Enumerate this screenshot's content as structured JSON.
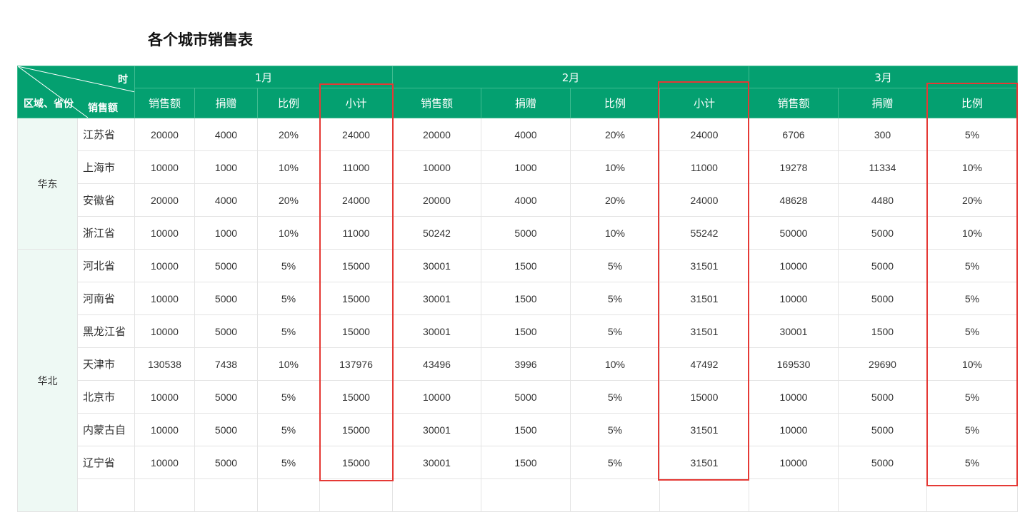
{
  "title": "各个城市销售表",
  "header": {
    "corner": {
      "time": "时",
      "region": "区域、省份",
      "sales": "销售额"
    },
    "months": [
      "1月",
      "2月",
      "3月"
    ],
    "subcols": {
      "sales": "销售额",
      "donation": "捐赠",
      "ratio": "比例",
      "subtotal": "小计"
    }
  },
  "regions": [
    {
      "name": "华东",
      "rows": [
        {
          "province": "江苏省",
          "m1": [
            "20000",
            "4000",
            "20%",
            "24000"
          ],
          "m2": [
            "20000",
            "4000",
            "20%",
            "24000"
          ],
          "m3": [
            "6706",
            "300",
            "5%"
          ]
        },
        {
          "province": "上海市",
          "m1": [
            "10000",
            "1000",
            "10%",
            "11000"
          ],
          "m2": [
            "10000",
            "1000",
            "10%",
            "11000"
          ],
          "m3": [
            "19278",
            "11334",
            "10%"
          ]
        },
        {
          "province": "安徽省",
          "m1": [
            "20000",
            "4000",
            "20%",
            "24000"
          ],
          "m2": [
            "20000",
            "4000",
            "20%",
            "24000"
          ],
          "m3": [
            "48628",
            "4480",
            "20%"
          ]
        },
        {
          "province": "浙江省",
          "m1": [
            "10000",
            "1000",
            "10%",
            "11000"
          ],
          "m2": [
            "50242",
            "5000",
            "10%",
            "55242"
          ],
          "m3": [
            "50000",
            "5000",
            "10%"
          ]
        }
      ]
    },
    {
      "name": "华北",
      "rows": [
        {
          "province": "河北省",
          "m1": [
            "10000",
            "5000",
            "5%",
            "15000"
          ],
          "m2": [
            "30001",
            "1500",
            "5%",
            "31501"
          ],
          "m3": [
            "10000",
            "5000",
            "5%"
          ]
        },
        {
          "province": "河南省",
          "m1": [
            "10000",
            "5000",
            "5%",
            "15000"
          ],
          "m2": [
            "30001",
            "1500",
            "5%",
            "31501"
          ],
          "m3": [
            "10000",
            "5000",
            "5%"
          ]
        },
        {
          "province": "黑龙江省",
          "m1": [
            "10000",
            "5000",
            "5%",
            "15000"
          ],
          "m2": [
            "30001",
            "1500",
            "5%",
            "31501"
          ],
          "m3": [
            "30001",
            "1500",
            "5%"
          ]
        },
        {
          "province": "天津市",
          "m1": [
            "130538",
            "7438",
            "10%",
            "137976"
          ],
          "m2": [
            "43496",
            "3996",
            "10%",
            "47492"
          ],
          "m3": [
            "169530",
            "29690",
            "10%"
          ]
        },
        {
          "province": "北京市",
          "m1": [
            "10000",
            "5000",
            "5%",
            "15000"
          ],
          "m2": [
            "10000",
            "5000",
            "5%",
            "15000"
          ],
          "m3": [
            "10000",
            "5000",
            "5%"
          ]
        },
        {
          "province": "内蒙古自",
          "m1": [
            "10000",
            "5000",
            "5%",
            "15000"
          ],
          "m2": [
            "30001",
            "1500",
            "5%",
            "31501"
          ],
          "m3": [
            "10000",
            "5000",
            "5%"
          ]
        },
        {
          "province": "辽宁省",
          "m1": [
            "10000",
            "5000",
            "5%",
            "15000"
          ],
          "m2": [
            "30001",
            "1500",
            "5%",
            "31501"
          ],
          "m3": [
            "10000",
            "5000",
            "5%"
          ]
        }
      ]
    }
  ],
  "colors": {
    "header_bg": "#04a070",
    "highlight": "#e53935",
    "region_bg": "#eef9f4"
  }
}
